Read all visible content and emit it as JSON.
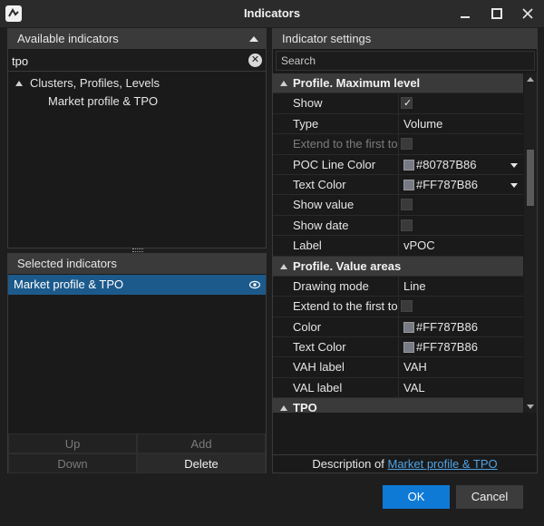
{
  "window": {
    "title": "Indicators"
  },
  "available": {
    "header": "Available indicators",
    "search_value": "tpo",
    "tree": [
      {
        "label": "Clusters, Profiles, Levels",
        "level": 0
      },
      {
        "label": "Market profile & TPO",
        "level": 1
      }
    ]
  },
  "selected": {
    "header": "Selected indicators",
    "items": [
      {
        "label": "Market profile & TPO"
      }
    ],
    "buttons": {
      "up": "Up",
      "add": "Add",
      "down": "Down",
      "delete": "Delete"
    }
  },
  "settings": {
    "header": "Indicator settings",
    "search_placeholder": "Search",
    "rows": [
      {
        "kind": "section",
        "name": "Profile. Maximum level"
      },
      {
        "kind": "check",
        "name": "Show",
        "checked": true
      },
      {
        "kind": "text",
        "name": "Type",
        "value": "Volume"
      },
      {
        "kind": "check",
        "name": "Extend to the first to",
        "checked": false,
        "disabled": true
      },
      {
        "kind": "color",
        "name": "POC Line Color",
        "value": "#80787B86",
        "swatch": "#787b86",
        "dropdown": true
      },
      {
        "kind": "color",
        "name": "Text Color",
        "value": "#FF787B86",
        "swatch": "#787b86",
        "dropdown": true
      },
      {
        "kind": "check",
        "name": "Show value",
        "checked": false
      },
      {
        "kind": "check",
        "name": "Show date",
        "checked": false
      },
      {
        "kind": "text",
        "name": "Label",
        "value": "vPOC"
      },
      {
        "kind": "section",
        "name": "Profile. Value areas"
      },
      {
        "kind": "text",
        "name": "Drawing mode",
        "value": "Line"
      },
      {
        "kind": "check",
        "name": "Extend to the first to",
        "checked": false
      },
      {
        "kind": "color",
        "name": "Color",
        "value": "#FF787B86",
        "swatch": "#787b86"
      },
      {
        "kind": "color",
        "name": "Text Color",
        "value": "#FF787B86",
        "swatch": "#787b86"
      },
      {
        "kind": "text",
        "name": "VAH label",
        "value": "VAH"
      },
      {
        "kind": "text",
        "name": "VAL label",
        "value": "VAL"
      },
      {
        "kind": "section",
        "name": "TPO"
      }
    ],
    "description_prefix": "Description of",
    "description_link": "Market profile & TPO"
  },
  "footer": {
    "ok": "OK",
    "cancel": "Cancel"
  },
  "colors": {
    "accent": "#0f7ad6",
    "selection": "#1c5a8c",
    "link": "#4ea3e6",
    "background": "#1e1e1e"
  }
}
